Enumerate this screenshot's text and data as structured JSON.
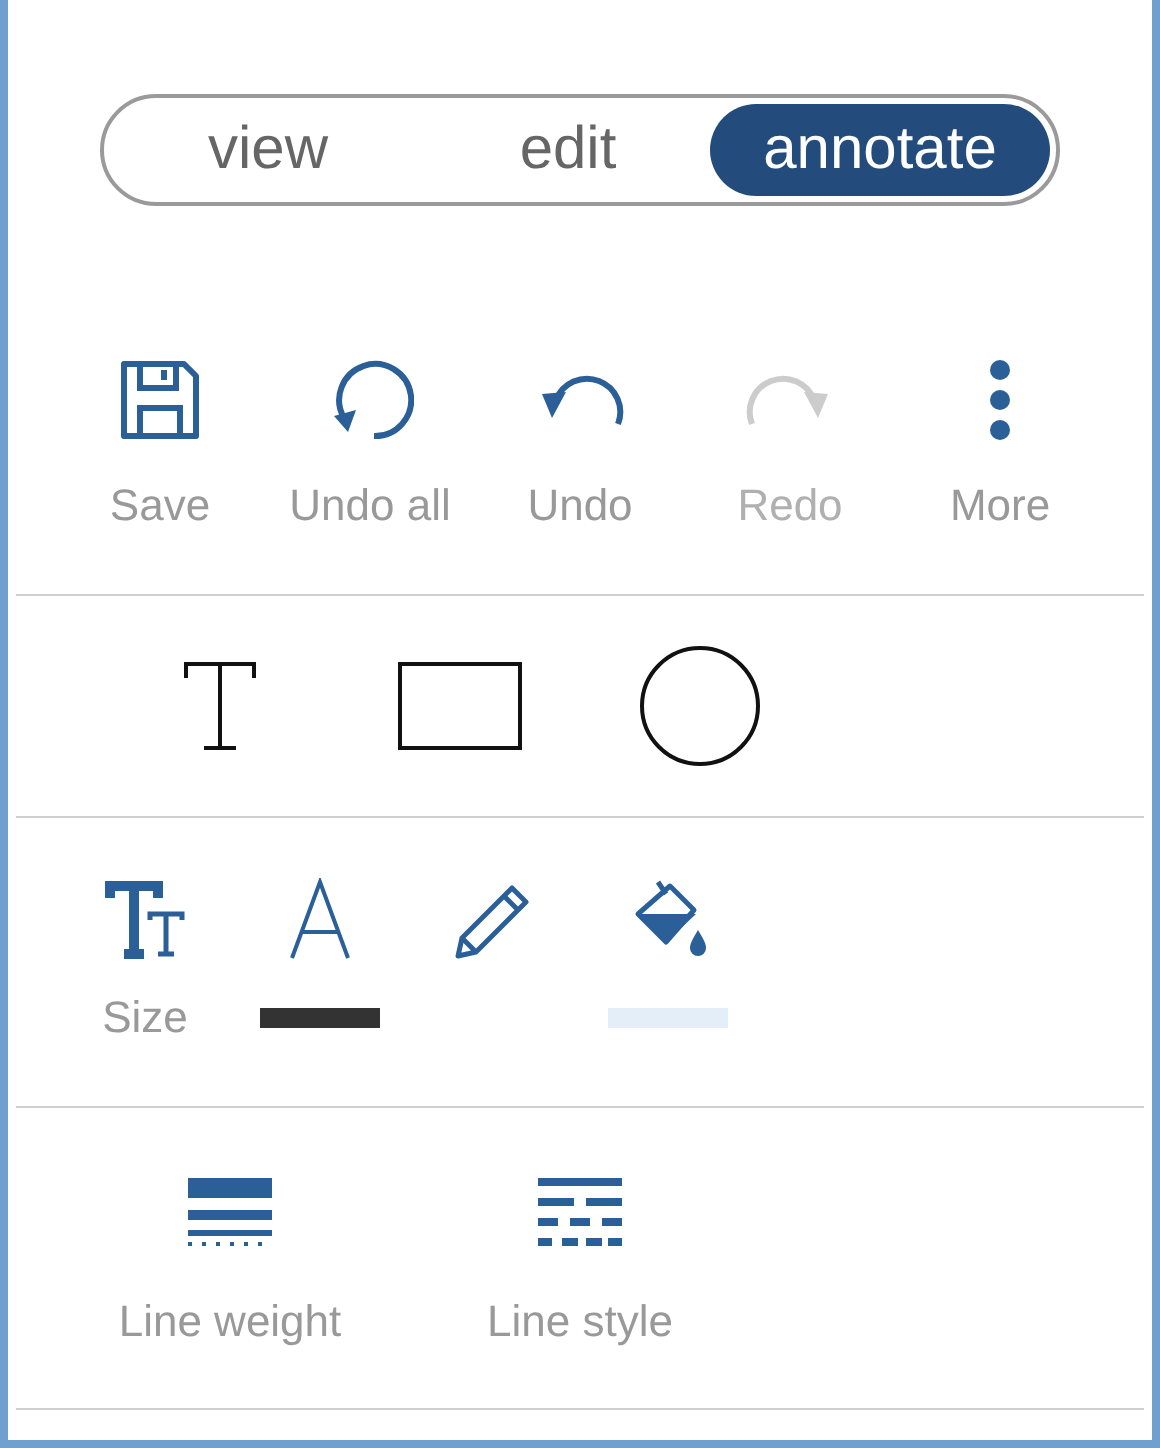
{
  "modes": [
    {
      "label": "view",
      "selected": false
    },
    {
      "label": "edit",
      "selected": false
    },
    {
      "label": "annotate",
      "selected": true
    }
  ],
  "actions": [
    {
      "kind": "save",
      "label": "Save",
      "disabled": false
    },
    {
      "kind": "undo-all",
      "label": "Undo all",
      "disabled": false
    },
    {
      "kind": "undo",
      "label": "Undo",
      "disabled": false
    },
    {
      "kind": "redo",
      "label": "Redo",
      "disabled": true
    },
    {
      "kind": "more",
      "label": "More",
      "disabled": false
    }
  ],
  "shapes": [
    {
      "kind": "text"
    },
    {
      "kind": "rectangle"
    },
    {
      "kind": "circle"
    }
  ],
  "style_tools": [
    {
      "kind": "size",
      "label": "Size"
    },
    {
      "kind": "text-color",
      "color": "#333333"
    },
    {
      "kind": "pencil"
    },
    {
      "kind": "fill",
      "color": "#e3eef8"
    }
  ],
  "line_tools": [
    {
      "kind": "line-weight",
      "label": "Line weight"
    },
    {
      "kind": "line-style",
      "label": "Line style"
    }
  ]
}
